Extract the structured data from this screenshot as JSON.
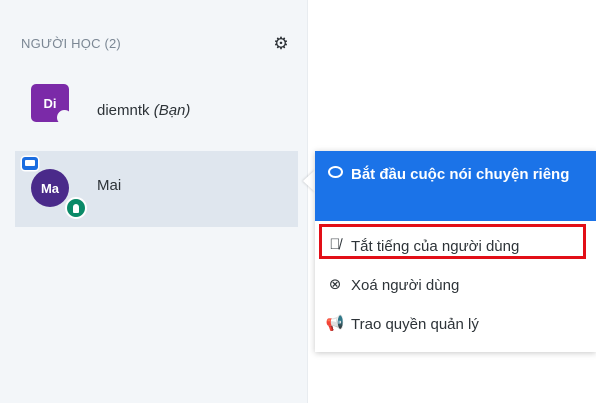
{
  "sidebar": {
    "header": "NGƯỜI HỌC (2)",
    "settings_icon": "gear-icon",
    "users": [
      {
        "initials": "Di",
        "name": "diemntk",
        "tag": "(Bạn)",
        "avatar_color": "#7b2aa8"
      },
      {
        "initials": "Ma",
        "name": "Mai",
        "avatar_color": "#4a2a8a",
        "selected": true
      }
    ]
  },
  "menu": {
    "items": [
      {
        "label": "Bắt đầu cuộc nói chuyện riêng",
        "icon": "chat-bubble-icon"
      },
      {
        "label": "Tắt tiếng của người dùng",
        "icon": "mute-microphone-icon",
        "highlighted": true
      },
      {
        "label": "Xoá người dùng",
        "icon": "remove-circle-icon"
      },
      {
        "label": "Trao quyền quản lý",
        "icon": "megaphone-icon"
      }
    ]
  },
  "colors": {
    "primary": "#1b73e8",
    "highlight": "#e20e17",
    "sidebar_bg": "#f3f6f9"
  }
}
